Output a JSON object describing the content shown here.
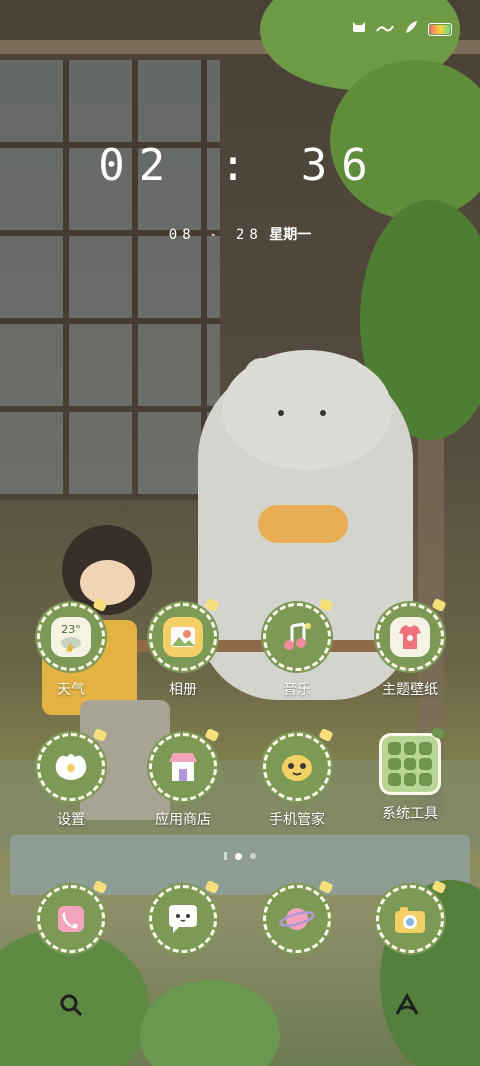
{
  "status": {
    "icons": [
      "cat-icon",
      "wave-icon",
      "leaf-icon",
      "battery-icon"
    ],
    "battery_level": 1.0
  },
  "clock": {
    "time": "02:36",
    "date": "08-28",
    "weekday": "星期一"
  },
  "weather": {
    "temp": "23°"
  },
  "apps_row1": [
    {
      "label": "天气",
      "icon": "weather-icon"
    },
    {
      "label": "相册",
      "icon": "gallery-icon"
    },
    {
      "label": "音乐",
      "icon": "music-icon"
    },
    {
      "label": "主题壁纸",
      "icon": "theme-icon"
    }
  ],
  "apps_row2": [
    {
      "label": "设置",
      "icon": "settings-icon"
    },
    {
      "label": "应用商店",
      "icon": "app-store-icon"
    },
    {
      "label": "手机管家",
      "icon": "phone-manager-icon"
    },
    {
      "label": "系统工具",
      "icon": "system-tools-folder"
    }
  ],
  "dock": [
    {
      "icon": "phone-icon"
    },
    {
      "icon": "message-icon"
    },
    {
      "icon": "browser-icon"
    },
    {
      "icon": "camera-icon"
    }
  ],
  "page_indicator": {
    "pages": 2,
    "current": 1
  },
  "bottom_bar": {
    "left_icon": "search-icon",
    "right_icon": "assistant-icon"
  },
  "colors": {
    "icon_bg": "#7c9a55",
    "icon_border": "#fdf8ea",
    "label": "#ffffff"
  }
}
